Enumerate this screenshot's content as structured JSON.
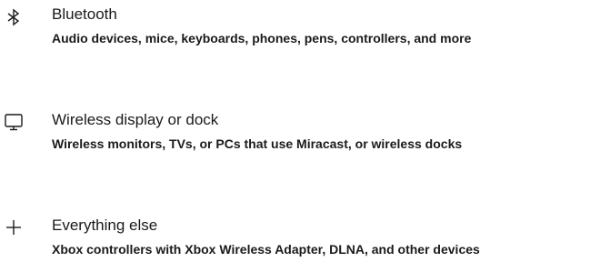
{
  "options": [
    {
      "title": "Bluetooth",
      "description": "Audio devices, mice, keyboards, phones, pens, controllers, and more",
      "icon": "bluetooth-icon"
    },
    {
      "title": "Wireless display or dock",
      "description": "Wireless monitors, TVs, or PCs that use Miracast, or wireless docks",
      "icon": "monitor-icon"
    },
    {
      "title": "Everything else",
      "description": "Xbox controllers with Xbox Wireless Adapter, DLNA, and other devices",
      "icon": "plus-icon"
    }
  ]
}
